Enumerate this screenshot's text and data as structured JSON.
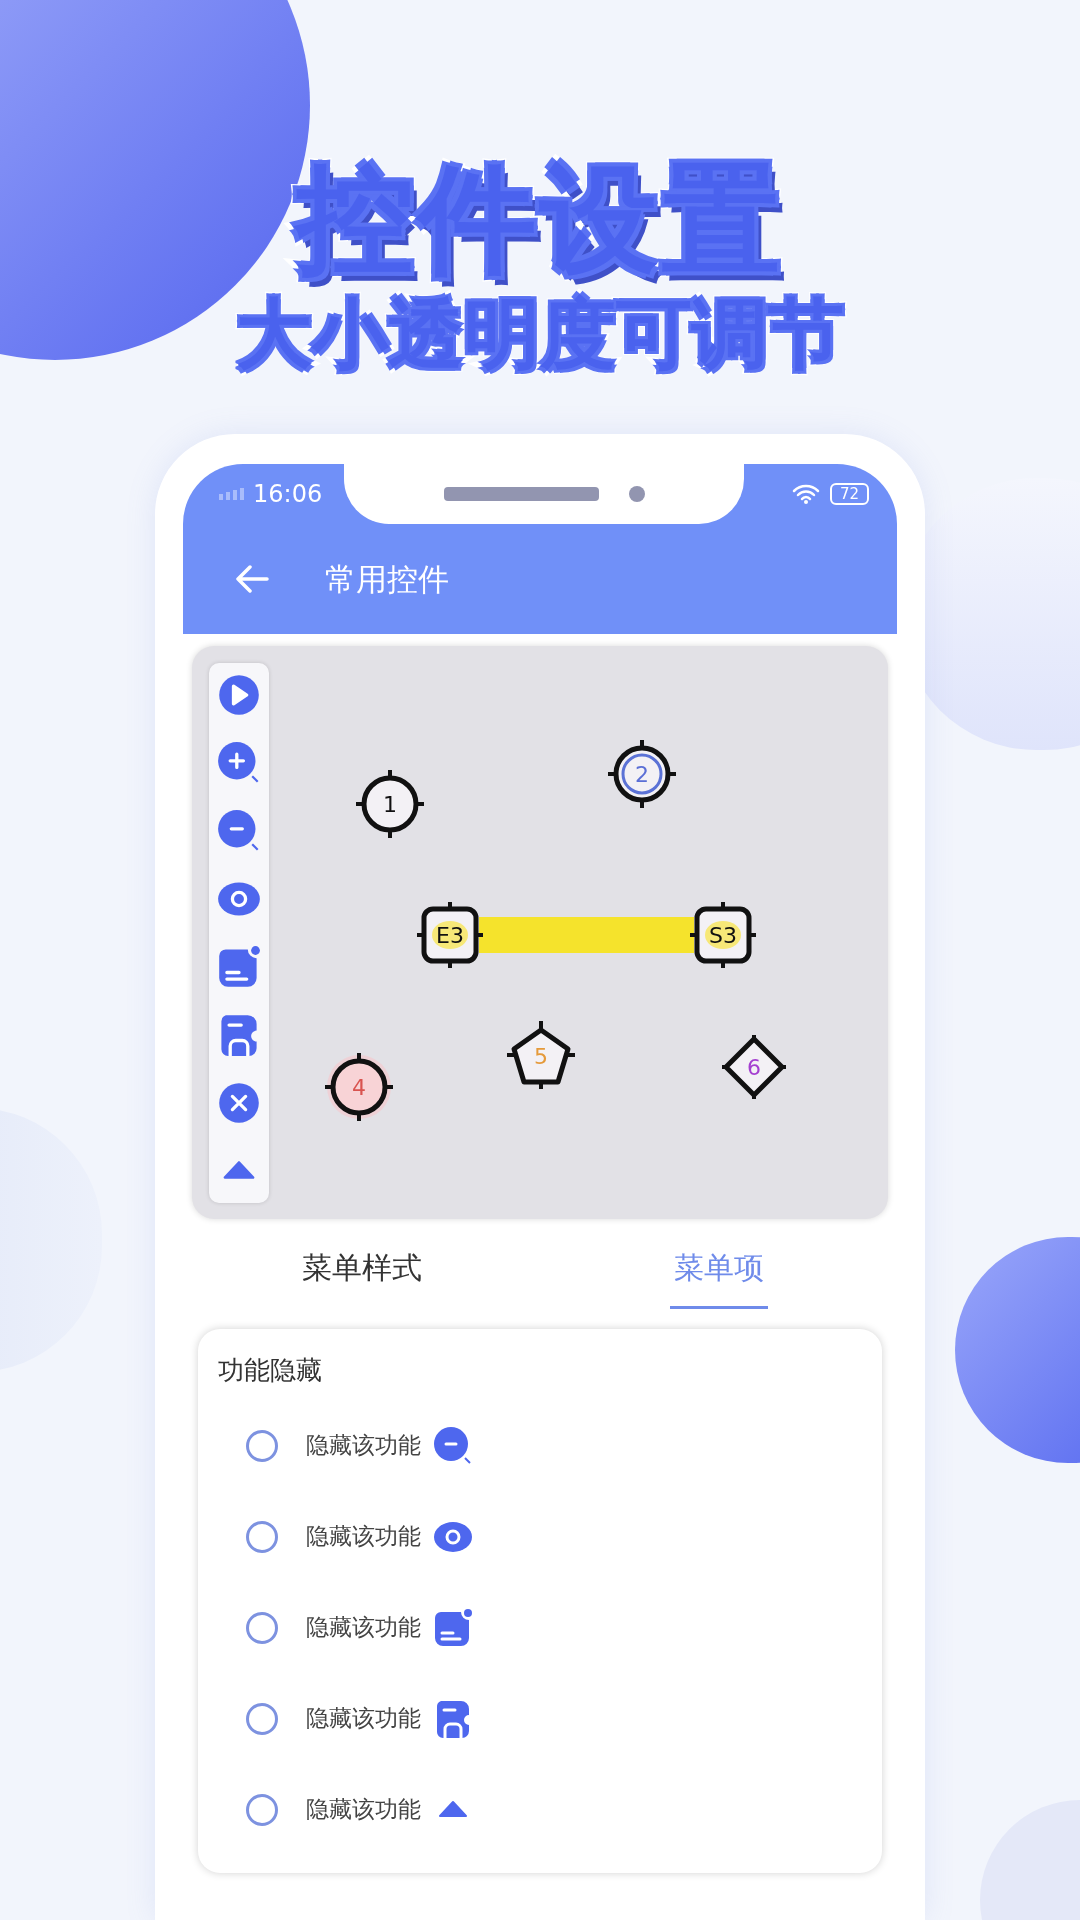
{
  "headline": "控件设置",
  "subheadline": "大小透明度可调节",
  "status_bar": {
    "time": "16:06",
    "battery": "72"
  },
  "app_bar": {
    "title": "常用控件"
  },
  "toolbar": [
    {
      "kind": "play"
    },
    {
      "kind": "zoomin"
    },
    {
      "kind": "zoomout"
    },
    {
      "kind": "eye"
    },
    {
      "kind": "note"
    },
    {
      "kind": "printer"
    },
    {
      "kind": "close"
    },
    {
      "kind": "caret"
    }
  ],
  "markers": [
    {
      "label": "1",
      "kind": "circle",
      "color": "#111111"
    },
    {
      "label": "2",
      "kind": "ring",
      "color": "#5b6fd6"
    },
    {
      "label": "E3",
      "kind": "square",
      "color": "#111111"
    },
    {
      "label": "S3",
      "kind": "square",
      "color": "#111111"
    },
    {
      "label": "4",
      "kind": "glow",
      "color": "#d9534f"
    },
    {
      "label": "5",
      "kind": "pentagon",
      "color": "#e59a3a"
    },
    {
      "label": "6",
      "kind": "diamond",
      "color": "#a43fd0"
    }
  ],
  "tabs": [
    {
      "label": "菜单样式",
      "selected": false
    },
    {
      "label": "菜单项",
      "selected": true
    }
  ],
  "card": {
    "title": "功能隐藏",
    "rows": [
      {
        "label": "隐藏该功能",
        "kind": "zoomout",
        "selected": false
      },
      {
        "label": "隐藏该功能",
        "kind": "eye",
        "selected": false
      },
      {
        "label": "隐藏该功能",
        "kind": "note",
        "selected": false
      },
      {
        "label": "隐藏该功能",
        "kind": "printer",
        "selected": false
      },
      {
        "label": "隐藏该功能",
        "kind": "caret",
        "selected": false
      }
    ]
  }
}
